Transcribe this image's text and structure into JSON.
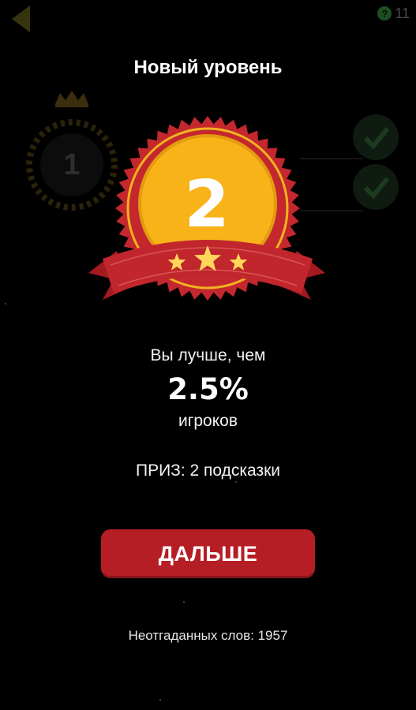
{
  "topbar": {
    "back_icon": "triangle-left-icon",
    "hints_count": "11",
    "hint_icon_glyph": "?"
  },
  "background": {
    "current_level": "1"
  },
  "popup": {
    "title": "Новый уровень",
    "level": "2",
    "better_than": "Вы лучше, чем",
    "percent": "2.5%",
    "players": "игроков",
    "prize": "ПРИЗ: 2 подсказки",
    "continue_label": "ДАЛЬШЕ",
    "unguessed_words": "Неотгаданных слов: 1957"
  },
  "colors": {
    "button_red": "#b61e25",
    "badge_red": "#c4272d",
    "badge_gold": "#f7b318",
    "star_gold": "#ffd65a",
    "back_arrow": "#36340f"
  }
}
